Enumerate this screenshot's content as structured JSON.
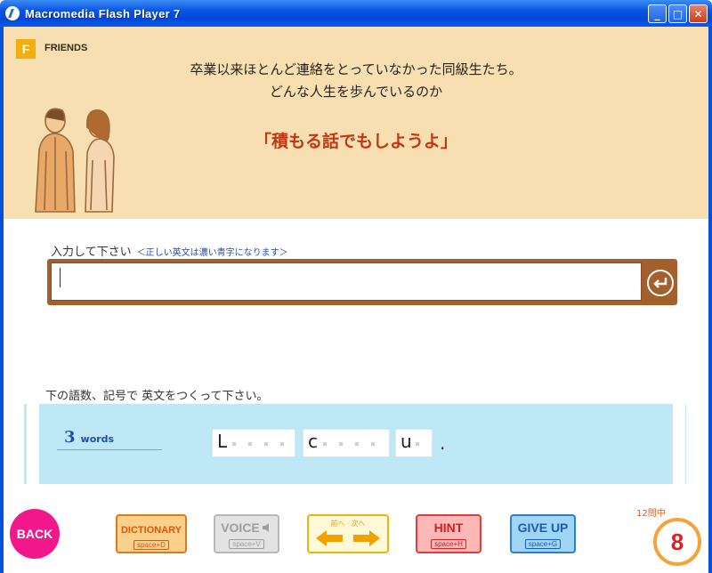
{
  "window": {
    "title": "Macromedia Flash Player 7",
    "min_glyph": "_",
    "max_glyph": "□",
    "close_glyph": "✕"
  },
  "header": {
    "badge": "F",
    "section": "FRIENDS",
    "desc_line1": "卒業以来ほとんど連絡をとっていなかった同級生たち。",
    "desc_line2": "どんな人生を歩んでいるのか",
    "headline": "「積もる話でもしようよ」"
  },
  "input": {
    "label": "入力して下さい",
    "hint": "＜正しい英文は濃い青字になります＞",
    "value": "",
    "enter_icon": "return-arrow-icon"
  },
  "puzzle": {
    "instruction": "下の語数、記号で 英文をつくって下さい。",
    "word_count": "3",
    "word_unit": "words",
    "tiles": [
      {
        "letter": "L",
        "blanks": 4
      },
      {
        "letter": "c",
        "blanks": 4
      },
      {
        "letter": "u",
        "blanks": 1
      }
    ],
    "terminator": "."
  },
  "toolbar": {
    "back_label": "BACK",
    "dictionary_label": "DICTIONARY",
    "dictionary_key": "space+D",
    "voice_label": "VOICE",
    "voice_key": "space+V",
    "prev_label": "前へ",
    "next_label": "次へ",
    "hint_label": "HINT",
    "hint_key": "space+H",
    "giveup_label": "GIVE UP",
    "giveup_key": "space+G"
  },
  "progress": {
    "total_label": "12問中",
    "current": "8"
  },
  "colors": {
    "header_bg": "#f7dfb1",
    "headline": "#c43612",
    "panel_bg": "#bfe8f7",
    "input_frame": "#a35f2c",
    "back_button": "#f2188c"
  }
}
